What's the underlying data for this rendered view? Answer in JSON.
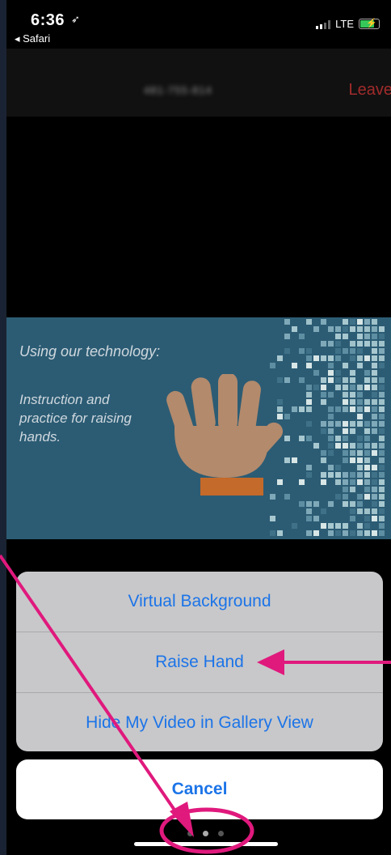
{
  "status_bar": {
    "time": "6:36",
    "back_app": "◂ Safari",
    "network": "LTE"
  },
  "meeting": {
    "id": "481-755-814",
    "leave_label": "Leave"
  },
  "slide": {
    "title": "Using our technology:",
    "body": "Instruction and practice for raising hands."
  },
  "action_sheet": {
    "options": [
      "Virtual Background",
      "Raise Hand",
      "Hide My Video in Gallery View"
    ],
    "cancel_label": "Cancel"
  },
  "page_indicator": {
    "count": 3,
    "active": 2
  },
  "colors": {
    "accent": "#1c74e8",
    "leave": "#a12b2b",
    "annotation": "#e0197d",
    "slide_bg": "#2c5c74"
  }
}
